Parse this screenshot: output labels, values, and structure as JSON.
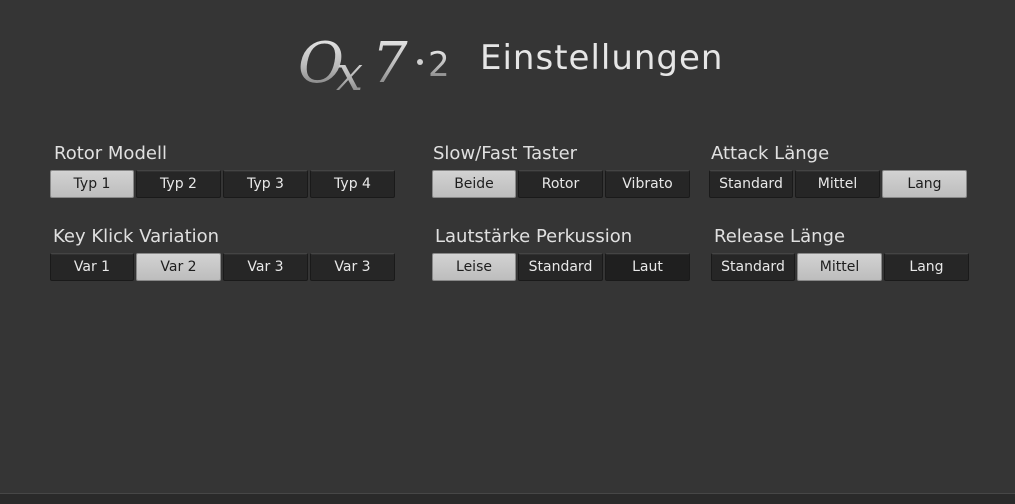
{
  "header": {
    "logo_text": "OX7·2",
    "title": "Einstellungen"
  },
  "groups": {
    "rotor_modell": {
      "label": "Rotor Modell",
      "options": [
        "Typ 1",
        "Typ 2",
        "Typ  3",
        "Typ  4"
      ],
      "selected": "Typ 1"
    },
    "key_klick": {
      "label": "Key Klick Variation",
      "options": [
        "Var 1",
        "Var 2",
        "Var 3",
        "Var 3"
      ],
      "selected": "Var 2"
    },
    "slow_fast": {
      "label": "Slow/Fast Taster",
      "options": [
        "Beide",
        "Rotor",
        "Vibrato"
      ],
      "selected": "Beide"
    },
    "lautstaerke": {
      "label": "Lautstärke Perkussion",
      "options": [
        "Leise",
        "Standard",
        "Laut"
      ],
      "selected": "Leise"
    },
    "attack": {
      "label": "Attack Länge",
      "options": [
        "Standard",
        "Mittel",
        "Lang"
      ],
      "selected": "Lang"
    },
    "release": {
      "label": "Release Länge",
      "options": [
        "Standard",
        "Mittel",
        "Lang"
      ],
      "selected": "Mittel"
    }
  },
  "colors": {
    "background": "#353535",
    "button_bg": "#262626",
    "button_active_bg": "#c8c8c8",
    "text": "#e8e8e8"
  }
}
